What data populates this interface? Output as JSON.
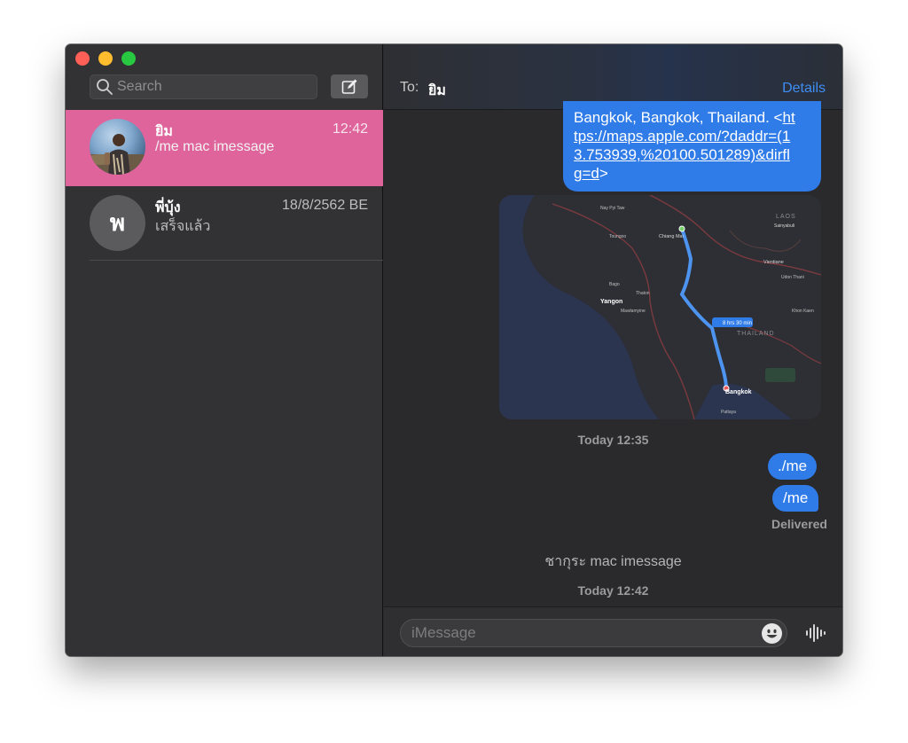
{
  "window": {
    "colors": {
      "selection": "#e0649c",
      "bubble": "#2f7be8",
      "accent": "#3f8ef5"
    }
  },
  "sidebar": {
    "search": {
      "placeholder": "Search",
      "value": ""
    },
    "compose_icon": "compose-icon",
    "conversations": [
      {
        "name": "ยิม",
        "time": "12:42",
        "preview": "/me mac imessage",
        "selected": true,
        "avatar": "photo"
      },
      {
        "name": "พี่บุ้ง",
        "time": "18/8/2562 BE",
        "preview": "เสร็จแล้ว",
        "selected": false,
        "avatar_initial": "พ"
      }
    ]
  },
  "chat": {
    "to_label": "To:",
    "recipient": "ยิม",
    "details_label": "Details",
    "messages": {
      "location_line": "Bangkok, Bangkok, Thailand. <",
      "location_url_1": "ht",
      "location_url_2": "tps://maps.apple.com/?daddr=(1",
      "location_url_3": "3.753939,%20100.501289)&dirfl",
      "location_url_4": "g=d",
      "location_close": ">",
      "map_route_badge": "8 hrs 30 min",
      "map_labels": {
        "laos": "LAOS",
        "thailand": "THAILAND",
        "chiang_mai": "Chiang Mai",
        "yangon": "Yangon",
        "bangkok": "Bangkok",
        "vientiane": "Vientiane",
        "udon_thani": "Udon Thani",
        "khon_kaen": "Khon Kaen",
        "pattaya": "Pattaya",
        "nay_pyi_taw": "Nay Pyi Taw",
        "toungoo": "Toungoo",
        "bago": "Bago",
        "mawlamyine": "Mawlamyine",
        "thaton": "Thaton",
        "sainyabuli": "Sainyabuli"
      },
      "timestamp_1": "Today 12:35",
      "bubble_me_1": "./me",
      "bubble_me_2": "/me",
      "delivered": "Delivered",
      "status_message": "ชากุระ mac imessage",
      "timestamp_2": "Today 12:42"
    },
    "composer": {
      "placeholder": "iMessage",
      "value": "",
      "emoji_icon": "emoji-icon",
      "audio_icon": "audio-waveform-icon"
    }
  }
}
